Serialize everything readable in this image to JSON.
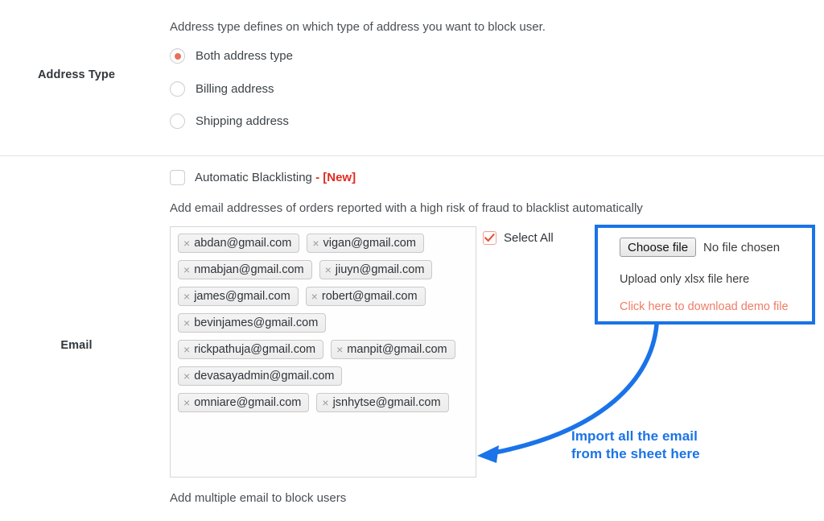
{
  "sections": {
    "address_type": {
      "label": "Address Type",
      "helper": "Address type defines on which type of address you want to block user.",
      "options": [
        {
          "label": "Both address type",
          "selected": true
        },
        {
          "label": "Billing address",
          "selected": false
        },
        {
          "label": "Shipping address",
          "selected": false
        }
      ]
    },
    "email": {
      "label": "Email",
      "automatic_blacklisting": {
        "label": "Automatic Blacklisting",
        "separator": "-",
        "badge": "[New]",
        "checked": false
      },
      "helper": "Add email addresses of orders reported with a high risk of fraud to blacklist automatically",
      "tags": [
        "abdan@gmail.com",
        "vigan@gmail.com",
        "nmabjan@gmail.com",
        "jiuyn@gmail.com",
        "james@gmail.com",
        "robert@gmail.com",
        "bevinjames@gmail.com",
        "rickpathuja@gmail.com",
        "manpit@gmail.com",
        "devasayadmin@gmail.com",
        "omniare@gmail.com",
        "jsnhytse@gmail.com"
      ],
      "tag_remove_glyph": "×",
      "select_all": {
        "label": "Select All",
        "checked": true
      },
      "upload": {
        "choose_button": "Choose file",
        "file_status": "No file chosen",
        "note": "Upload only xlsx file here",
        "demo_link": "Click here to download demo file"
      },
      "bottom_note": "Add multiple email to block users"
    }
  },
  "annotation": {
    "line1": "Import all the email",
    "line2": "from the sheet here",
    "color": "#1a73e8"
  },
  "colors": {
    "accent_red": "#e8705a",
    "badge_red": "#e02b20",
    "annotation_blue": "#1a73e8",
    "demo_link": "#ef7c66",
    "divider": "#e4e4e4"
  }
}
